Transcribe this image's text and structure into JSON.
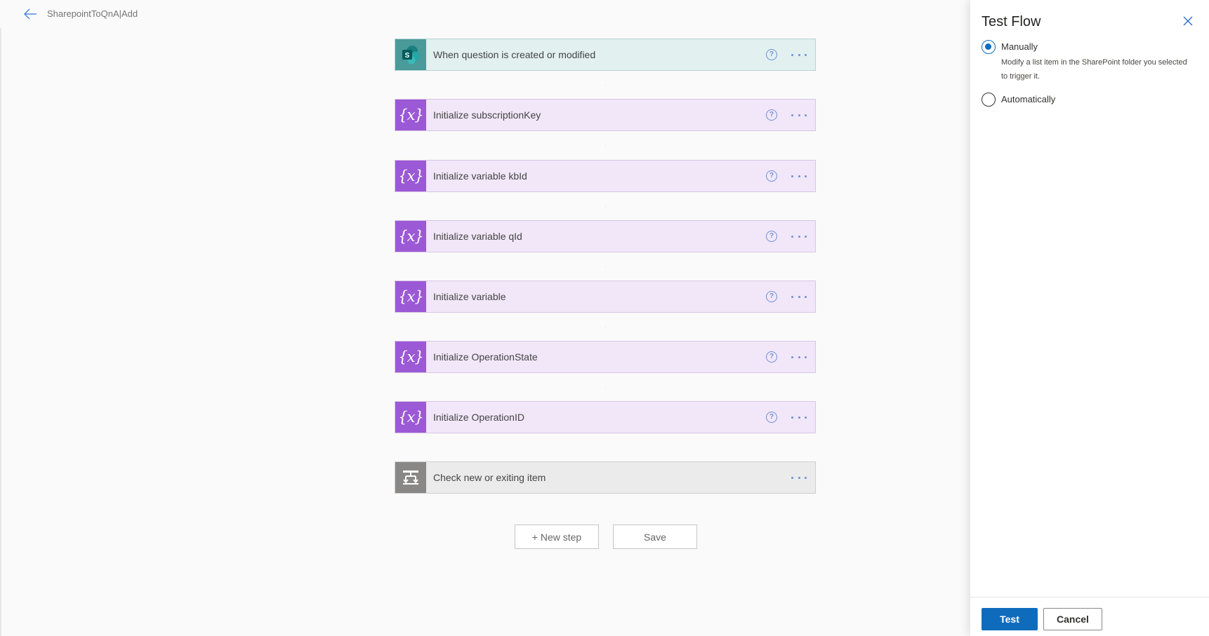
{
  "header": {
    "flow_name": "SharepointToQnA|Add"
  },
  "steps": [
    {
      "title": "When question is created or modified",
      "kind": "trigger",
      "icon": "sharepoint-icon"
    },
    {
      "title": "Initialize subscriptionKey",
      "kind": "variable",
      "icon": "variable-icon"
    },
    {
      "title": "Initialize variable kbId",
      "kind": "variable",
      "icon": "variable-icon"
    },
    {
      "title": "Initialize variable qId",
      "kind": "variable",
      "icon": "variable-icon"
    },
    {
      "title": "Initialize variable",
      "kind": "variable",
      "icon": "variable-icon"
    },
    {
      "title": "Initialize OperationState",
      "kind": "variable",
      "icon": "variable-icon"
    },
    {
      "title": "Initialize OperationID",
      "kind": "variable",
      "icon": "variable-icon"
    },
    {
      "title": "Check new or exiting item",
      "kind": "condition",
      "icon": "condition-icon"
    }
  ],
  "icons": {
    "variable_glyph": "{x}",
    "sharepoint_letter": "S",
    "help_glyph": "?"
  },
  "actions": {
    "new_step_label": "+ New step",
    "save_label": "Save"
  },
  "panel": {
    "title": "Test Flow",
    "options": [
      {
        "label": "Manually",
        "checked": true,
        "description": "Modify a list item in the SharePoint folder you selected to trigger it."
      },
      {
        "label": "Automatically",
        "checked": false
      }
    ],
    "test_label": "Test",
    "cancel_label": "Cancel"
  },
  "colors": {
    "accent": "#0f6cbd",
    "trigger_icon_bg": "#4a9a9a",
    "variable_icon_bg": "#9b59d6",
    "condition_icon_bg": "#8a8886"
  }
}
